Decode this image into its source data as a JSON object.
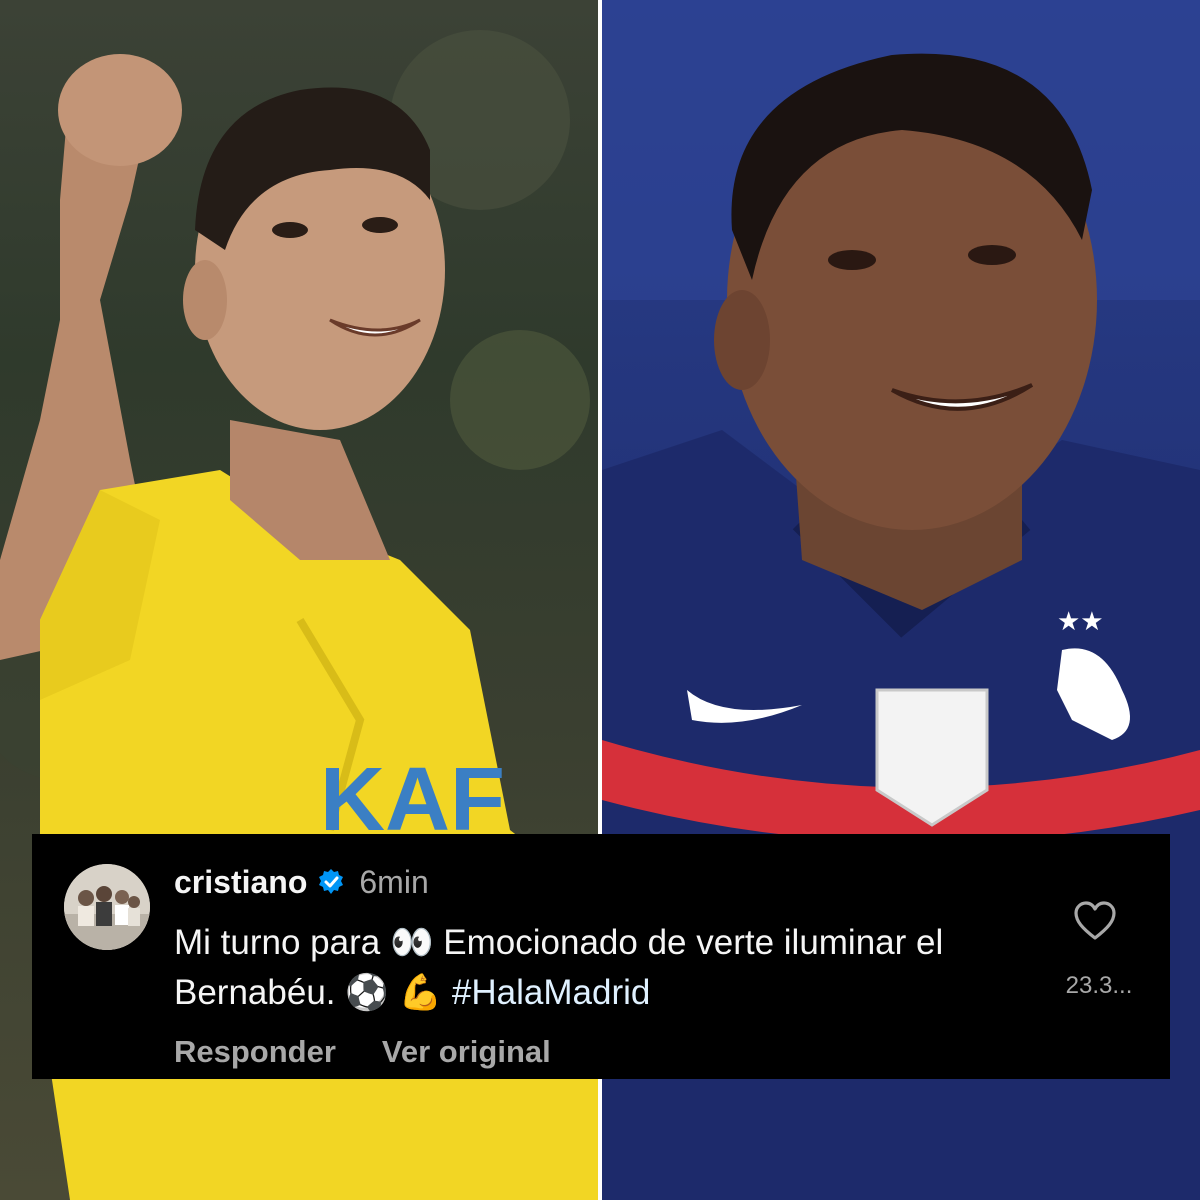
{
  "comment": {
    "username": "cristiano",
    "verified": true,
    "timestamp": "6min",
    "text_part1": "Mi turno para",
    "emoji_eyes": "👀",
    "text_part2": "Emocionado de verte iluminar el Bernabéu.",
    "emoji_ball": "⚽",
    "emoji_muscle": "💪",
    "hashtag": "#HalaMadrid",
    "like_count": "23.3...",
    "reply_label": "Responder",
    "see_original_label": "Ver original"
  },
  "colors": {
    "card_bg": "#000000",
    "text_primary": "#f5f5f5",
    "text_secondary": "#a8a8a8",
    "verified_blue": "#0095f6",
    "hashtag": "#e0f1ff"
  }
}
